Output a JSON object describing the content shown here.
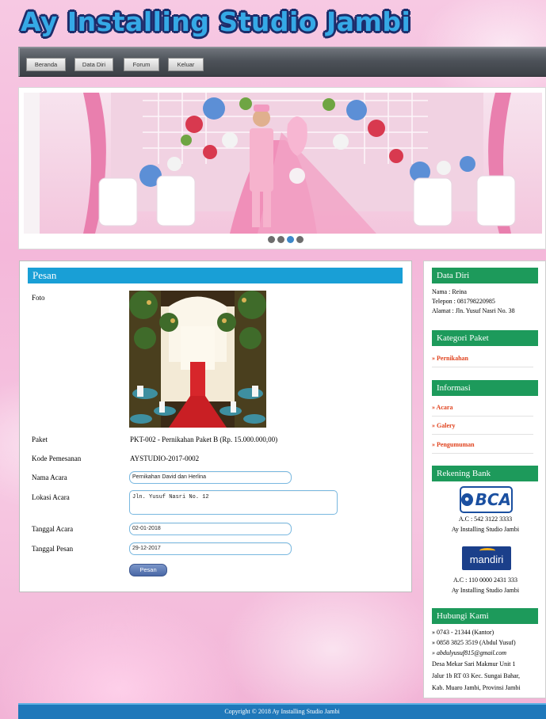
{
  "header": {
    "title": "Ay Installing Studio Jambi"
  },
  "nav": [
    {
      "label": "Beranda"
    },
    {
      "label": "Data Diri"
    },
    {
      "label": "Forum"
    },
    {
      "label": "Keluar"
    }
  ],
  "slider": {
    "slide_count": 4,
    "active_index": 2
  },
  "form": {
    "title": "Pesan",
    "foto_label": "Foto",
    "paket_label": "Paket",
    "paket_value": "PKT-002 - Pernikahan Paket B (Rp. 15.000.000,00)",
    "kode_label": "Kode Pemesanan",
    "kode_value": "AYSTUDIO-2017-0002",
    "nama_acara_label": "Nama Acara",
    "nama_acara_value": "Pernikahan David dan Herlina",
    "lokasi_label": "Lokasi Acara",
    "lokasi_value": "Jln. Yusuf Nasri No. 12",
    "tanggal_acara_label": "Tanggal Acara",
    "tanggal_acara_value": "02-01-2018",
    "tanggal_pesan_label": "Tanggal Pesan",
    "tanggal_pesan_value": "29-12-2017",
    "submit_label": "Pesan"
  },
  "sidebar": {
    "data_diri": {
      "title": "Data Diri",
      "nama": "Nama : Reina",
      "telepon": "Telepon : 081798220985",
      "alamat": "Alamat : Jln. Yusuf Nasri No. 38"
    },
    "kategori": {
      "title": "Kategori Paket",
      "items": [
        "» Pernikahan"
      ]
    },
    "informasi": {
      "title": "Informasi",
      "items": [
        "» Acara",
        "» Galery",
        "» Pengumuman"
      ]
    },
    "rekening": {
      "title": "Rekening Bank",
      "banks": [
        {
          "logo": "BCA",
          "account": "A.C : 542 3122 3333",
          "owner": "Ay Installing Studio Jambi"
        },
        {
          "logo": "mandiri",
          "account": "A.C : 110 0000 2431 333",
          "owner": "Ay Installing Studio Jambi"
        }
      ]
    },
    "hubungi": {
      "title": "Hubungi Kami",
      "lines": [
        "» 0743 - 21344 (Kantor)",
        "» 0858 3825 3519 (Abdul Yusuf)",
        "» abdulyusuf815@gmail.com",
        "Desa Mekar Sari Makmur Unit 1",
        "Jalur 1b RT 03 Kec. Sungai Bahar,",
        "Kab. Muaro Jambi, Provinsi Jambi"
      ]
    }
  },
  "footer": {
    "text": "Copyright © 2018 Ay Installing Studio Jambi"
  },
  "colors": {
    "nav": "#4d5259",
    "form_header": "#199fd6",
    "sidebar_header": "#1d9a5b",
    "link": "#e0431e",
    "footer": "#1f78ba"
  }
}
